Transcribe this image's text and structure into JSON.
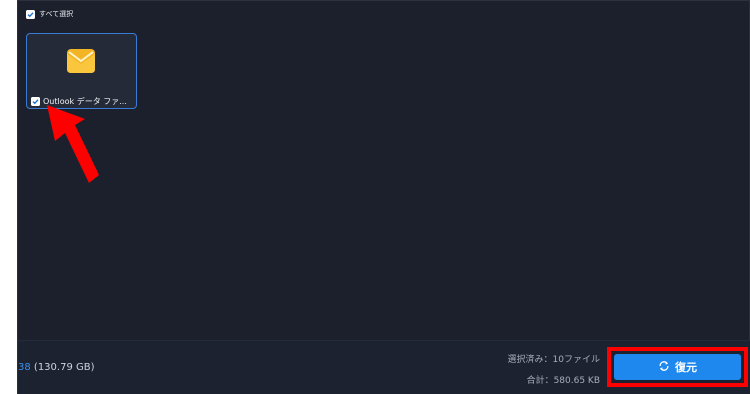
{
  "toolbar": {
    "select_all_label": "すべて選択",
    "select_all_checked": true
  },
  "files": [
    {
      "name": "Outlook データ ファ...",
      "icon": "mail-icon",
      "checked": true
    }
  ],
  "footer": {
    "storage_value": "38",
    "storage_total": "(130.79 GB)",
    "selected_text": "選択済み：10ファイル",
    "total_text": "合計：580.65 KB",
    "recover_label": "復元",
    "recover_icon": "recover-icon"
  },
  "annotations": {
    "highlight_color": "#ff0000",
    "arrow_icon": "red-arrow-icon"
  },
  "colors": {
    "background": "#1c202c",
    "accent": "#1e88ef",
    "card": "#252a38"
  }
}
